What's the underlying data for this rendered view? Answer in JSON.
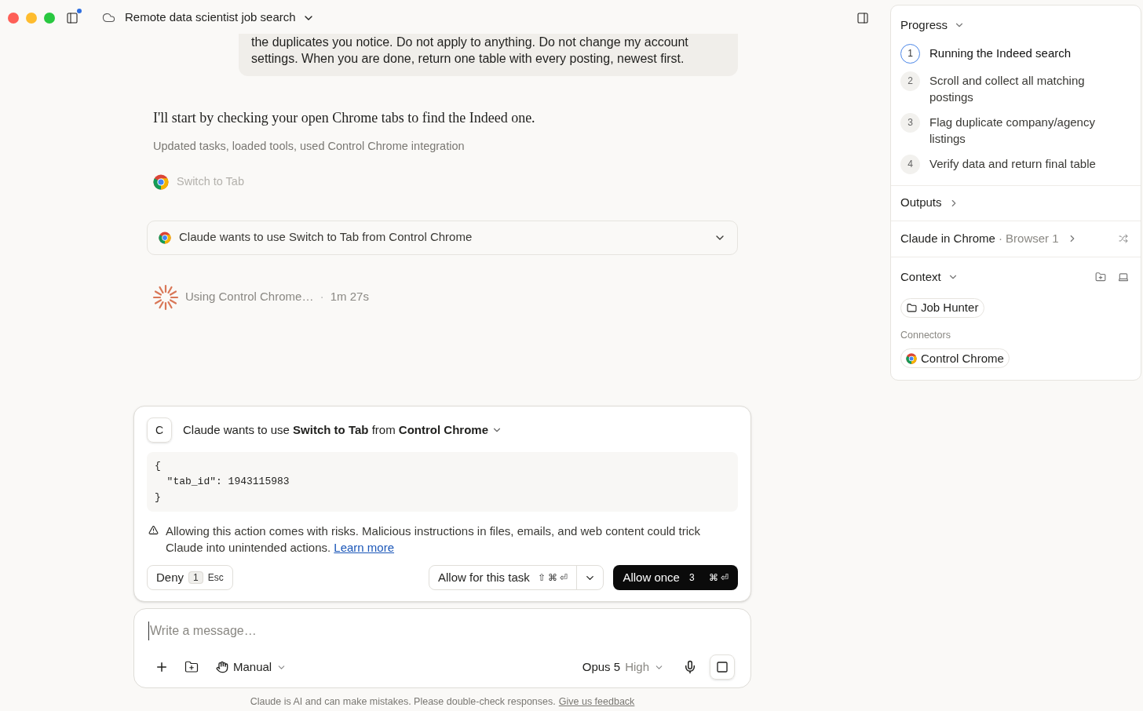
{
  "window": {
    "title": "Remote data scientist job search"
  },
  "user_message": {
    "lines": [
      "the duplicates you notice. Do not apply to anything. Do not change my account",
      "settings. When you are done, return one table with every posting, newest first."
    ]
  },
  "assistant": {
    "text": "I'll start by checking your open Chrome tabs to find the Indeed one.",
    "summary": "Updated tasks, loaded tools, used Control Chrome integration",
    "tool_step": "Switch to Tab",
    "permission_row": {
      "text": "Claude wants to use Switch to Tab from Control Chrome",
      "expanded": false
    },
    "working": {
      "label": "Using Control Chrome…",
      "separator": "·",
      "elapsed": "1m 27s"
    }
  },
  "prompt": {
    "avatar": "C",
    "title": "Claude wants to use **Switch to Tab** from **Control Chrome**",
    "code": [
      "{",
      "  \"tab_id\": 1943115983",
      "}"
    ],
    "warning": "Allowing this action comes with risks. Malicious instructions in files, emails, and web content could trick Claude into unintended actions.",
    "learn_more": "Learn more",
    "deny": {
      "label": "Deny",
      "key": "1",
      "shortcut": "Esc"
    },
    "allow_task": {
      "label": "Allow for this task",
      "shortcut": "⇧ ⌘ ⏎"
    },
    "allow_once": {
      "label": "Allow once",
      "key": "3",
      "shortcut": "⌘ ⏎"
    }
  },
  "composer": {
    "placeholder": "Write a message…",
    "mode": "Manual",
    "model": "Opus 5",
    "effort": "High"
  },
  "footer": {
    "text": "Claude is AI and can make mistakes. Please double-check responses.",
    "link": "Give us feedback"
  },
  "panel": {
    "progress": {
      "title": "Progress",
      "steps": [
        {
          "number": "1",
          "label": "Running the Indeed search",
          "selected": true
        },
        {
          "number": "2",
          "label": "Scroll and collect all matching postings",
          "selected": false
        },
        {
          "number": "3",
          "label": "Flag duplicate company/agency listings",
          "selected": false
        },
        {
          "number": "4",
          "label": "Verify data and return final table",
          "selected": false
        }
      ]
    },
    "outputs": {
      "title": "Outputs"
    },
    "browser": {
      "title": "Claude in Chrome",
      "detail": "· Browser 1"
    },
    "context": {
      "title": "Context",
      "folder": "Job Hunter",
      "connectors_label": "Connectors",
      "connector": "Control Chrome"
    }
  }
}
